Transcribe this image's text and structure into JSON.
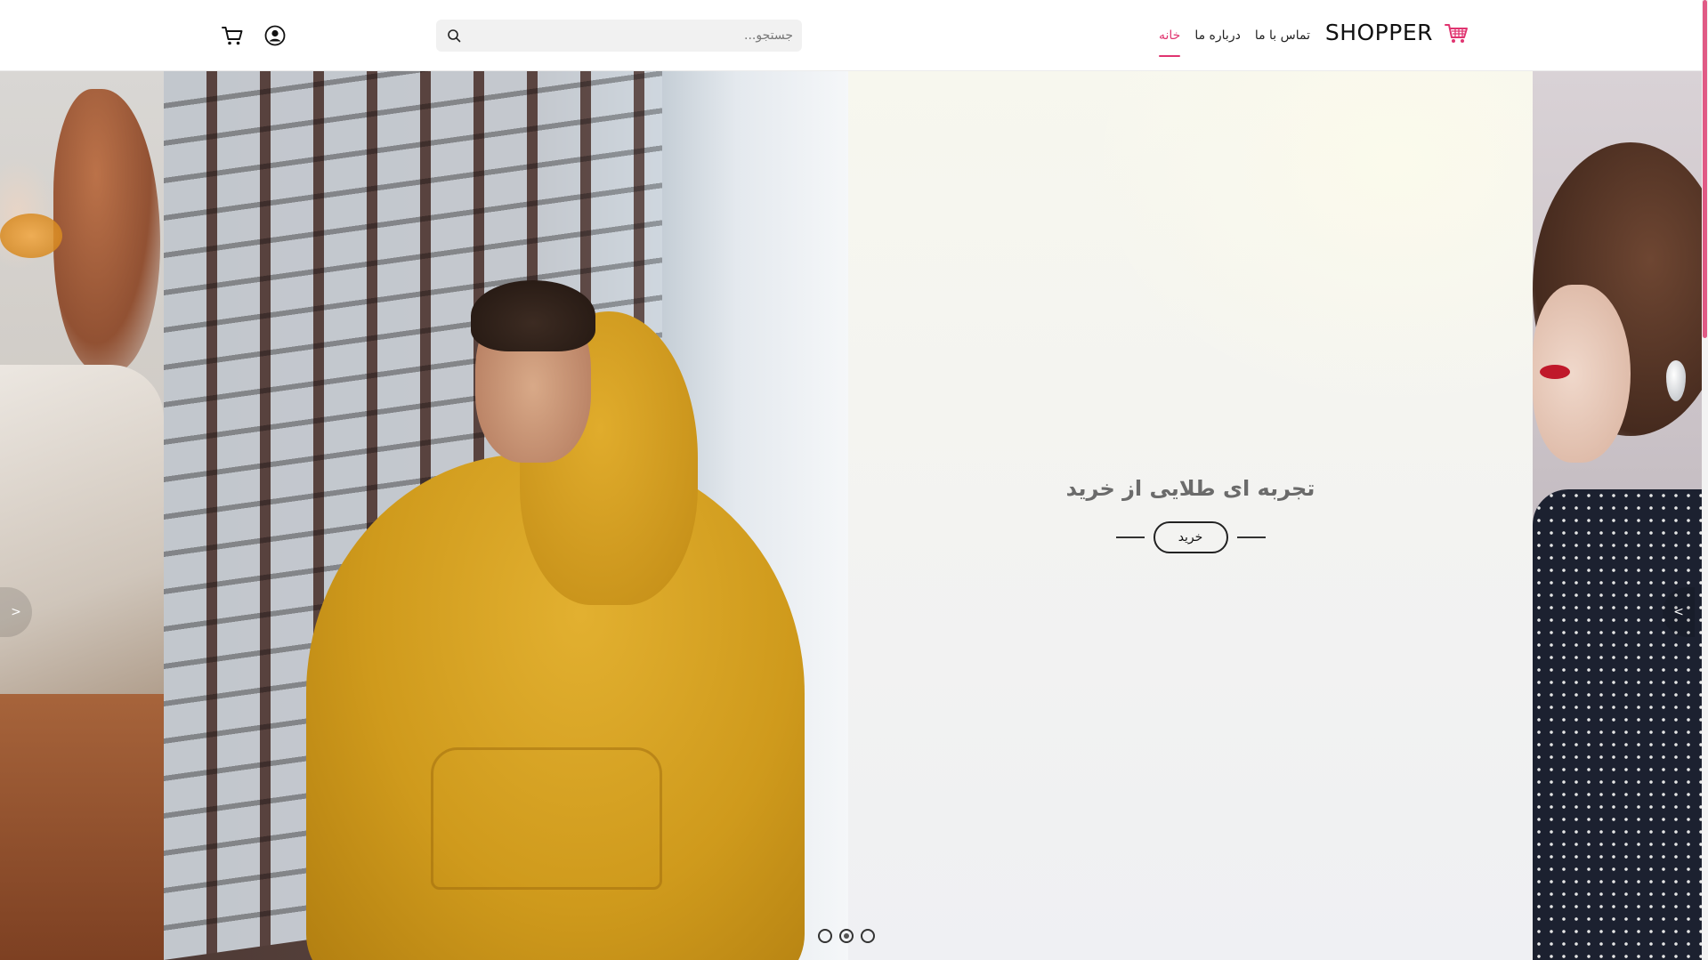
{
  "header": {
    "brand": "SHOPPER",
    "nav": [
      {
        "label": "خانه",
        "active": true
      },
      {
        "label": "درباره ما",
        "active": false
      },
      {
        "label": "تماس با ما",
        "active": false
      }
    ],
    "search": {
      "placeholder": "جستجو...",
      "value": ""
    },
    "icons": {
      "search": "search-icon",
      "user": "user-circle-icon",
      "cart": "cart-icon",
      "brand": "shopping-cart-logo-icon"
    },
    "accent_color": "#e03470"
  },
  "hero": {
    "title": "تجربه ای طلایی از خرید",
    "cta_label": "خرید",
    "prev_label": ">",
    "next_label": "<",
    "slide_count": 3,
    "active_slide": 2
  }
}
